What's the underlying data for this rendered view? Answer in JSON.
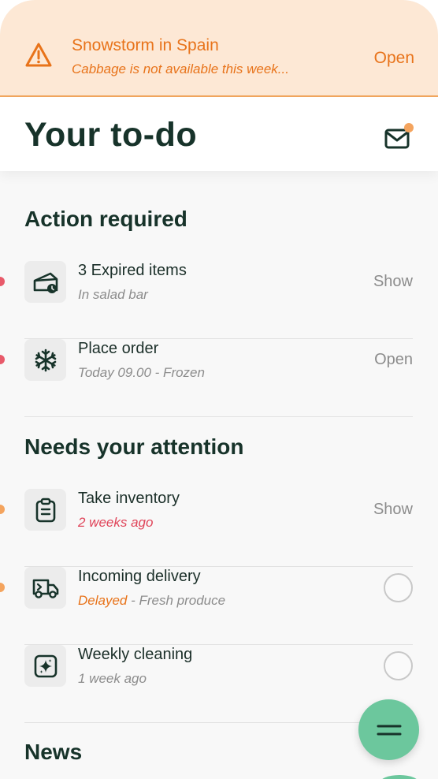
{
  "alert": {
    "title": "Snowstorm in Spain",
    "subtitle": "Cabbage is not available this week...",
    "action": "Open",
    "color": "#e8731a",
    "background": "#fde8d5",
    "icon": "warning-triangle-icon"
  },
  "header": {
    "title": "Your to-do",
    "icon": "mail-icon",
    "has_notification": true
  },
  "sections": {
    "action_required": {
      "title": "Action required",
      "items": [
        {
          "title": "3 Expired items",
          "subtitle": "In salad bar",
          "action": "Show",
          "icon": "expired-cheese-icon",
          "indicator_color": "#e85a6a"
        },
        {
          "title": "Place order",
          "subtitle": "Today 09.00 - Frozen",
          "action": "Open",
          "icon": "snowflake-icon",
          "indicator_color": "#e85a6a"
        }
      ]
    },
    "needs_attention": {
      "title": "Needs your attention",
      "items": [
        {
          "title": "Take inventory",
          "subtitle": "2 weeks ago",
          "subtitle_color": "#e0455a",
          "action": "Show",
          "icon": "clipboard-icon",
          "indicator_color": "#f4a45e"
        },
        {
          "title": "Incoming delivery",
          "subtitle_highlight": "Delayed",
          "subtitle_highlight_color": "#e8731a",
          "subtitle": " - Fresh produce",
          "checked": false,
          "icon": "delivery-truck-icon",
          "indicator_color": "#f4a45e"
        },
        {
          "title": "Weekly cleaning",
          "subtitle": "1 week ago",
          "checked": false,
          "icon": "sparkle-clean-icon"
        }
      ]
    },
    "news": {
      "title": "News"
    }
  },
  "fab": {
    "icon": "menu-icon",
    "color": "#6cc79d"
  }
}
